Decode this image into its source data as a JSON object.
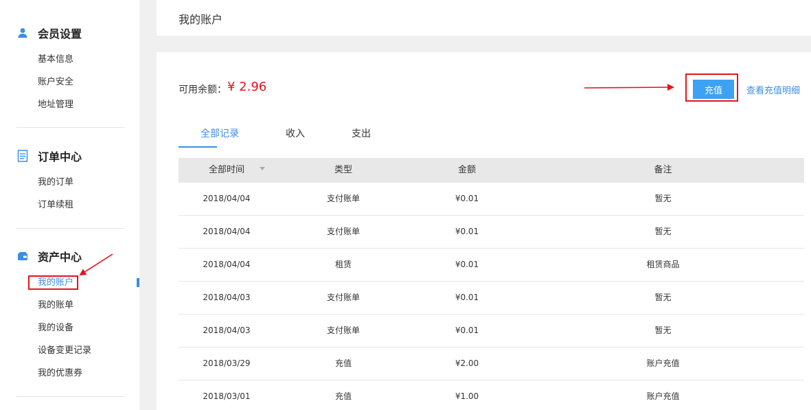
{
  "sidebar": {
    "groups": [
      {
        "title": "会员设置",
        "icon": "user-icon",
        "items": [
          "基本信息",
          "账户安全",
          "地址管理"
        ]
      },
      {
        "title": "订单中心",
        "icon": "document-icon",
        "items": [
          "我的订单",
          "订单续租"
        ]
      },
      {
        "title": "资产中心",
        "icon": "wallet-icon",
        "items": [
          "我的账户",
          "我的账单",
          "我的设备",
          "设备变更记录",
          "我的优惠券"
        ]
      }
    ],
    "active_item": "我的账户"
  },
  "page": {
    "title": "我的账户"
  },
  "balance": {
    "label": "可用余额：",
    "value": "¥ 2.96"
  },
  "actions": {
    "recharge_label": "充值",
    "detail_link": "查看充值明细"
  },
  "tabs": [
    {
      "label": "全部记录",
      "active": true
    },
    {
      "label": "收入",
      "active": false
    },
    {
      "label": "支出",
      "active": false
    }
  ],
  "table": {
    "headers": [
      "全部时间",
      "类型",
      "金额",
      "备注"
    ],
    "rows": [
      [
        "2018/04/04",
        "支付账单",
        "¥0.01",
        "暂无"
      ],
      [
        "2018/04/04",
        "支付账单",
        "¥0.01",
        "暂无"
      ],
      [
        "2018/04/04",
        "租赁",
        "¥0.01",
        "租赁商品"
      ],
      [
        "2018/04/03",
        "支付账单",
        "¥0.01",
        "暂无"
      ],
      [
        "2018/04/03",
        "支付账单",
        "¥0.01",
        "暂无"
      ],
      [
        "2018/03/29",
        "充值",
        "¥2.00",
        "账户充值"
      ],
      [
        "2018/03/01",
        "充值",
        "¥1.00",
        "账户充值"
      ]
    ]
  },
  "colors": {
    "accent": "#3a8ee6",
    "button": "#3da2f3",
    "price": "#e5121b",
    "annotation": "#e5121b"
  }
}
